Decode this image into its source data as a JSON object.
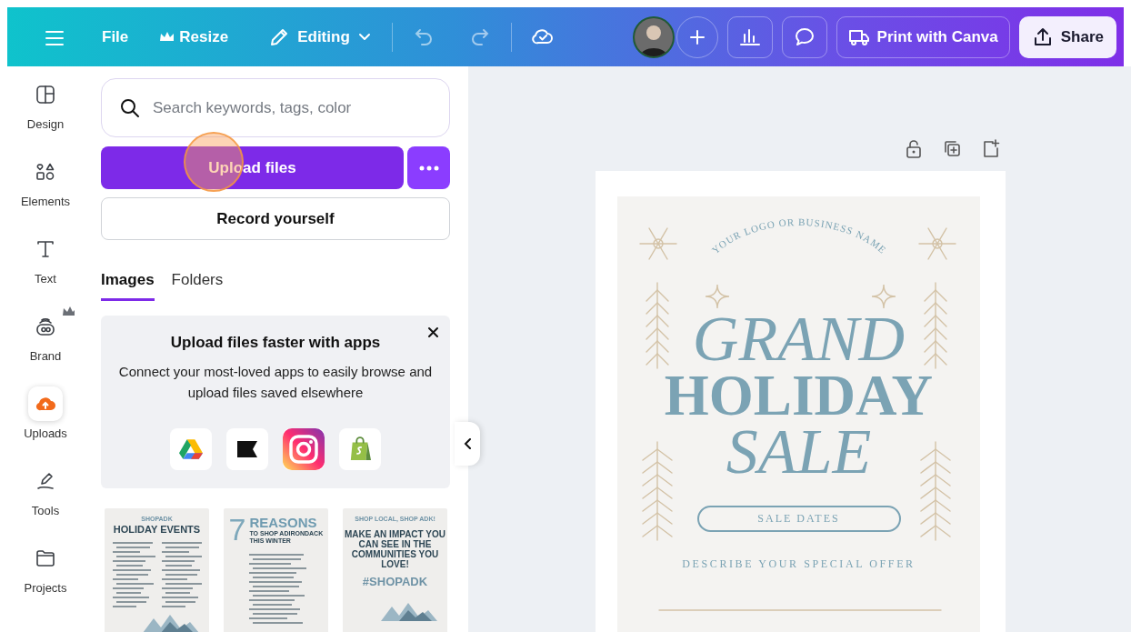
{
  "topbar": {
    "file_menu": "File",
    "resize_button": "Resize",
    "mode_menu": "Editing",
    "print_button": "Print with Canva",
    "share_button": "Share"
  },
  "sidebar": {
    "items": [
      {
        "label": "Design",
        "kind": "design",
        "selected": false,
        "premium": false
      },
      {
        "label": "Elements",
        "kind": "elements",
        "selected": false,
        "premium": false
      },
      {
        "label": "Text",
        "kind": "text",
        "selected": false,
        "premium": false
      },
      {
        "label": "Brand",
        "kind": "brand",
        "selected": false,
        "premium": true
      },
      {
        "label": "Uploads",
        "kind": "uploads",
        "selected": true,
        "premium": false
      },
      {
        "label": "Tools",
        "kind": "tools",
        "selected": false,
        "premium": false
      },
      {
        "label": "Projects",
        "kind": "projects",
        "selected": false,
        "premium": false
      }
    ]
  },
  "panel": {
    "search": {
      "placeholder": "Search keywords, tags, color"
    },
    "upload_button": "Upload files",
    "record_button": "Record yourself",
    "tabs": [
      {
        "label": "Images",
        "selected": true
      },
      {
        "label": "Folders",
        "selected": false
      }
    ],
    "promo": {
      "title": "Upload files faster with apps",
      "text": "Connect your most-loved apps to easily browse and upload files saved elsewhere",
      "apps": [
        {
          "kind": "drive"
        },
        {
          "kind": "flag"
        },
        {
          "kind": "camera"
        },
        {
          "kind": "bag"
        }
      ]
    },
    "thumbnails": [
      {
        "kind": "events",
        "eyebrow": "SHOPADK",
        "title": "HOLIDAY EVENTS"
      },
      {
        "kind": "reasons",
        "number": "7",
        "title": "REASONS",
        "subtitle": "TO SHOP ADIRONDACK THIS WINTER"
      },
      {
        "kind": "impact",
        "eyebrow": "SHOP LOCAL, SHOP ADK!",
        "title": "MAKE AN IMPACT YOU CAN SEE IN THE COMMUNITIES YOU LOVE!",
        "tag": "#SHOPADK"
      }
    ]
  },
  "design": {
    "logo_text": "YOUR LOGO OR BUSINESS NAME",
    "line1": "GRAND",
    "line2": "HOLIDAY",
    "line3": "SALE",
    "dates": "SALE DATES",
    "offer": "DESCRIBE YOUR SPECIAL OFFER"
  }
}
